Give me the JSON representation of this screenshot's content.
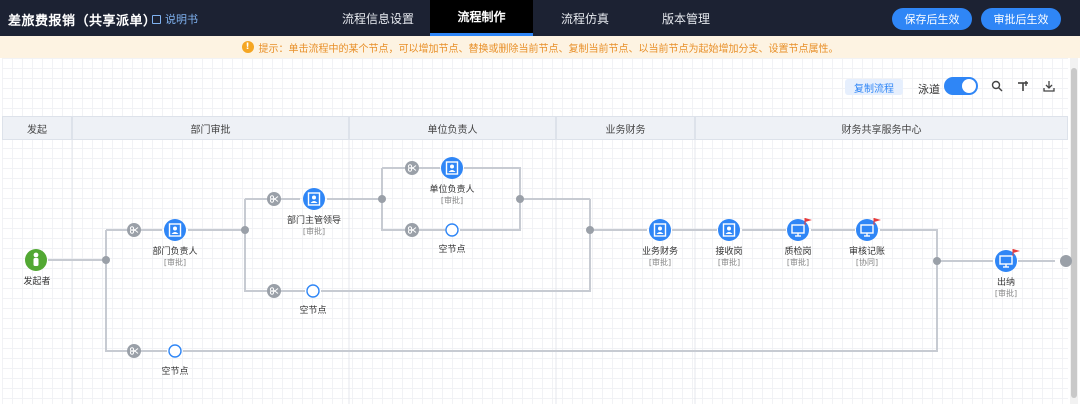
{
  "header": {
    "title": "差旅费报销（共享派单）",
    "help_label": "说明书",
    "tabs": [
      {
        "label": "流程信息设置"
      },
      {
        "label": "流程制作"
      },
      {
        "label": "流程仿真"
      },
      {
        "label": "版本管理"
      }
    ],
    "save_button": "保存后生效",
    "approve_button": "审批后生效"
  },
  "notice": {
    "text": "提示：单击流程中的某个节点，可以增加节点、替换或删除当前节点、复制当前节点、以当前节点为起始增加分支、设置节点属性。"
  },
  "toolbar": {
    "copy_flow": "复制流程",
    "swimlane_label": "泳道",
    "swimlane_on": true,
    "icons": [
      "search-icon",
      "format-icon",
      "download-icon"
    ]
  },
  "lanes": [
    "发起",
    "部门审批",
    "单位负责人",
    "业务财务",
    "财务共享服务中心"
  ],
  "nodes": {
    "initiator": "发起者",
    "dept_head": {
      "label": "部门负责人",
      "sub": "[审批]"
    },
    "dept_leader": {
      "label": "部门主管领导",
      "sub": "[审批]"
    },
    "unit_head": {
      "label": "单位负责人",
      "sub": "[审批]"
    },
    "empty_label": "空节点",
    "biz_finance": {
      "label": "业务财务",
      "sub": "[审批]"
    },
    "receiver": {
      "label": "接收岗",
      "sub": "[审批]"
    },
    "qc": {
      "label": "质检岗",
      "sub": "[审批]"
    },
    "review": {
      "label": "审核记账",
      "sub": "[协同]"
    },
    "cashier": {
      "label": "出纳",
      "sub": "[审批]"
    }
  },
  "colors": {
    "accent": "#2f86f6",
    "header_bg": "#1c2233",
    "start_green": "#52a833",
    "flag_red": "#e63b3b"
  }
}
